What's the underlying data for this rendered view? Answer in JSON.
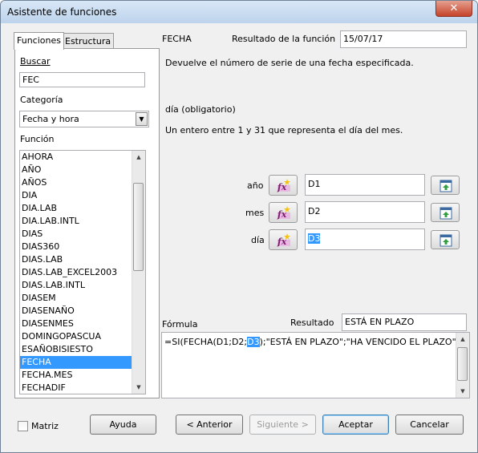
{
  "window": {
    "title": "Asistente de funciones",
    "close_glyph": "✕"
  },
  "tabs": [
    {
      "label": "Funciones"
    },
    {
      "label": "Estructura"
    }
  ],
  "search": {
    "label": "Buscar",
    "value": "FEC"
  },
  "category": {
    "label": "Categoría",
    "value": "Fecha y hora"
  },
  "function_list": {
    "label": "Función",
    "items": [
      "AHORA",
      "AÑO",
      "AÑOS",
      "DIA",
      "DIA.LAB",
      "DIA.LAB.INTL",
      "DIAS",
      "DIAS360",
      "DIAS.LAB",
      "DIAS.LAB_EXCEL2003",
      "DIAS.LAB.INTL",
      "DIASEM",
      "DIASENAÑO",
      "DIASENMES",
      "DOMINGOPASCUA",
      "ESAÑOBISIESTO",
      "FECHA",
      "FECHA.MES",
      "FECHADIF"
    ],
    "selected": "FECHA"
  },
  "details": {
    "function_name": "FECHA",
    "result_label": "Resultado de la función",
    "result_value": "15/07/17",
    "description": "Devuelve el número de serie de una fecha especificada.",
    "param_name": "día (obligatorio)",
    "param_description": "Un entero entre 1 y 31 que representa el día del mes."
  },
  "arguments": [
    {
      "label": "año",
      "value": "D1",
      "highlighted": false
    },
    {
      "label": "mes",
      "value": "D2",
      "highlighted": false
    },
    {
      "label": "día",
      "value": "D3",
      "highlighted": true
    }
  ],
  "formula": {
    "label": "Fórmula",
    "result_label": "Resultado",
    "result_value": "ESTÁ EN PLAZO",
    "text_before": "=SI(FECHA(D1;D2;",
    "text_highlight": "D3",
    "text_after": ");\"ESTÁ EN PLAZO\";\"HA VENCIDO EL PLAZO\")"
  },
  "footer": {
    "matrix_label": "Matriz",
    "help_label": "Ayuda",
    "back_label": "< Anterior",
    "next_label": "Siguiente >",
    "accept_label": "Aceptar",
    "cancel_label": "Cancelar"
  },
  "icons": {
    "fx_icon": "function-wizard-icon",
    "shrink_icon": "shrink-select-icon"
  },
  "colors": {
    "selection": "#3399ff",
    "titlebar": "#bcd3ec",
    "close": "#c6432a"
  }
}
